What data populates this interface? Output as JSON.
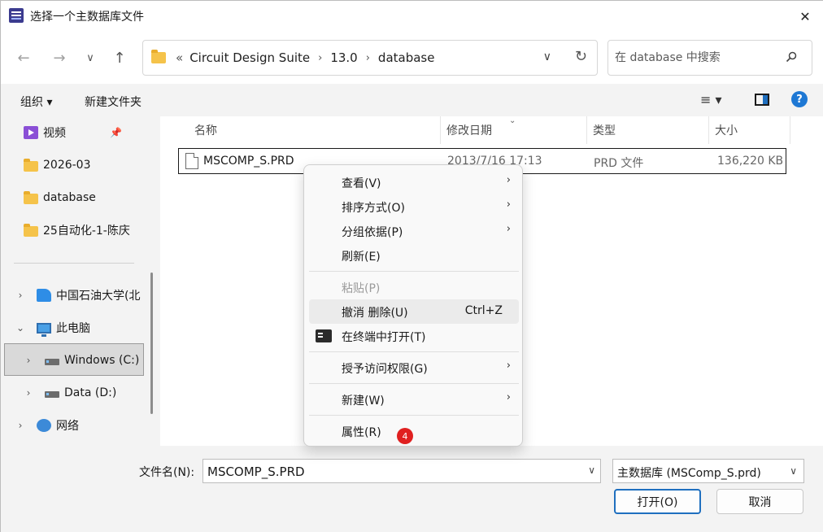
{
  "window": {
    "title": "选择一个主数据库文件"
  },
  "nav": {
    "back": "←",
    "forward": "→",
    "recent": "∨",
    "up": "↑"
  },
  "address": {
    "prefix": "«",
    "crumbs": [
      "Circuit Design Suite",
      "13.0",
      "database"
    ]
  },
  "search": {
    "placeholder": "在 database 中搜索"
  },
  "toolbar": {
    "organize": "组织 ▾",
    "new_folder": "新建文件夹",
    "view": "≡ ▾",
    "help": "?"
  },
  "sidebar": {
    "items": [
      {
        "label": "视频"
      },
      {
        "label": "2026-03"
      },
      {
        "label": "database"
      },
      {
        "label": "25自动化-1-陈庆"
      },
      {
        "label": "中国石油大学(北"
      },
      {
        "label": "此电脑"
      },
      {
        "label": "Windows (C:)"
      },
      {
        "label": "Data (D:)"
      },
      {
        "label": "网络"
      }
    ]
  },
  "columns": {
    "name": "名称",
    "date": "修改日期",
    "type": "类型",
    "size": "大小"
  },
  "file": {
    "name": "MSCOMP_S.PRD",
    "date": "2013/7/16 17:13",
    "type": "PRD 文件",
    "size": "136,220 KB"
  },
  "context_menu": {
    "view": "查看(V)",
    "sort": "排序方式(O)",
    "group": "分组依据(P)",
    "refresh": "刷新(E)",
    "paste": "粘贴(P)",
    "undo": "撤消 删除(U)",
    "undo_shortcut": "Ctrl+Z",
    "terminal": "在终端中打开(T)",
    "access": "授予访问权限(G)",
    "new": "新建(W)",
    "properties": "属性(R)",
    "badge": "4"
  },
  "bottom": {
    "filename_label": "文件名(N):",
    "filename_value": "MSCOMP_S.PRD",
    "filetype_value": "主数据库 (MSComp_S.prd)",
    "open": "打开(O)",
    "cancel": "取消"
  }
}
